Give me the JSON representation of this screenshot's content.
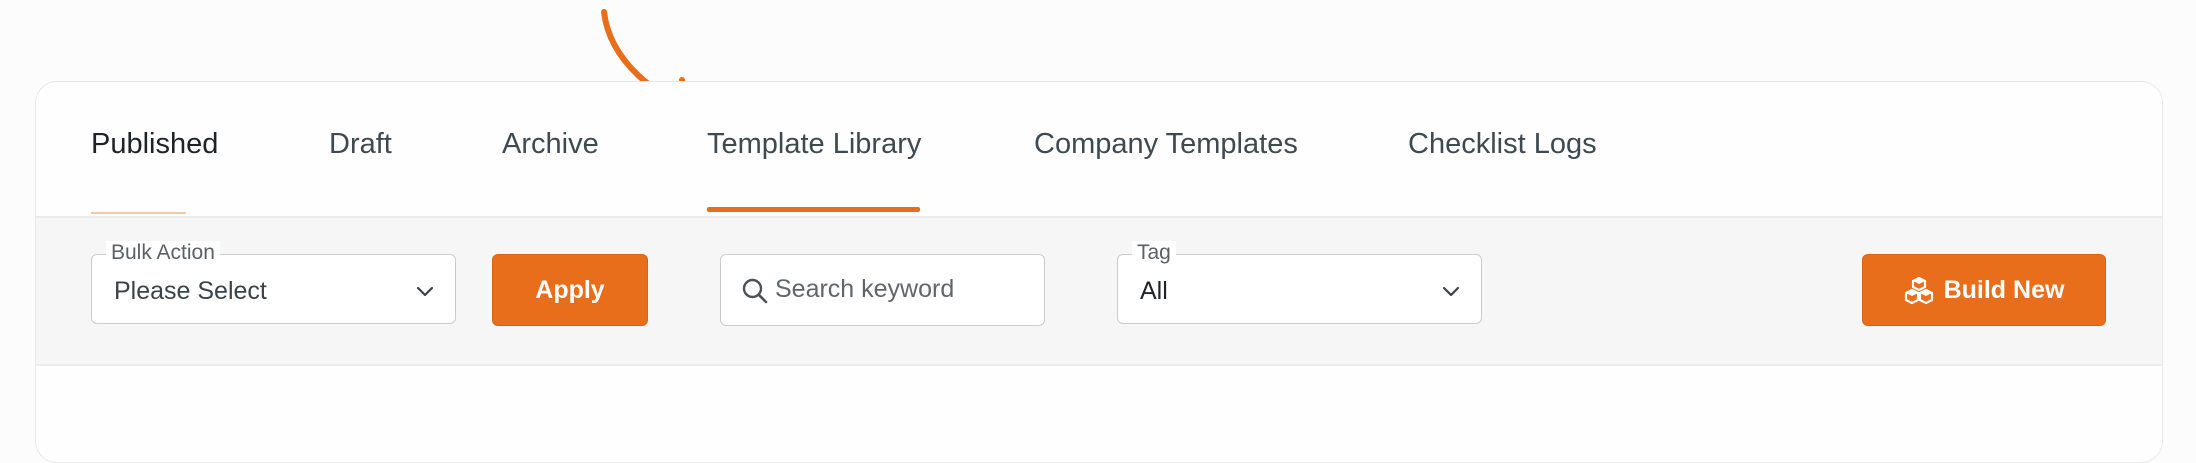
{
  "tabs": [
    {
      "label": "Published"
    },
    {
      "label": "Draft"
    },
    {
      "label": "Archive"
    },
    {
      "label": "Template Library"
    },
    {
      "label": "Company Templates"
    },
    {
      "label": "Checklist Logs"
    }
  ],
  "active_tab": "Template Library",
  "toolbar": {
    "bulk_action": {
      "label": "Bulk Action",
      "value": "Please Select"
    },
    "apply_label": "Apply",
    "search": {
      "placeholder": "Search keyword"
    },
    "tag": {
      "label": "Tag",
      "value": "All"
    },
    "build_new_label": "Build New"
  },
  "icons": {
    "annotation": "curved-arrow-icon",
    "search": "search-icon",
    "dropdown": "chevron-down-icon",
    "build": "cubes-icon"
  },
  "colors": {
    "accent": "#e86e1b",
    "text": "#3d4a52",
    "border": "#c9cdd0",
    "toolbar_bg": "#f6f6f6"
  }
}
